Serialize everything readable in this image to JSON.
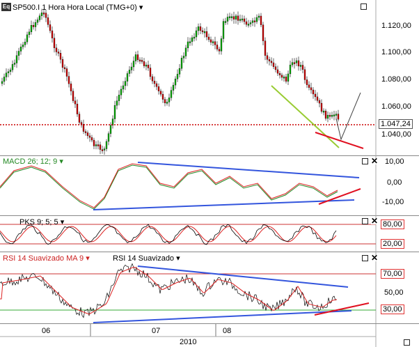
{
  "price_pane": {
    "logo": "Eq",
    "title": "SP500.I 1 Hora Hora Local (TMG+0)",
    "dropdown_glyph": "▾",
    "y_ticks": [
      "1.120,00",
      "1.100,00",
      "1.080,00",
      "1.060,00",
      "1.040,00"
    ],
    "current_price": "1.047,24",
    "colors": {
      "up": "#009900",
      "down": "#cc0000",
      "support": "#cc0000",
      "trend": "#99cc33"
    }
  },
  "macd_pane": {
    "title": "MACD 26; 12; 9",
    "y_ticks": [
      "10,00",
      "0,00",
      "-10,00"
    ],
    "close_glyph": "✕"
  },
  "pks_pane": {
    "title": "PKS 9; 5; 5",
    "levels": [
      "80,00",
      "20,00"
    ],
    "close_glyph": "✕"
  },
  "rsi_pane": {
    "title_ma": "RSI 14 Suavizado MA 9",
    "title_rsi": "RSI 14 Suavizado",
    "levels": [
      "70,00",
      "30,00"
    ],
    "mid_tick": "50,00",
    "close_glyph": "✕"
  },
  "time_axis": {
    "months": [
      "06",
      "07",
      "08"
    ],
    "year": "2010"
  }
}
